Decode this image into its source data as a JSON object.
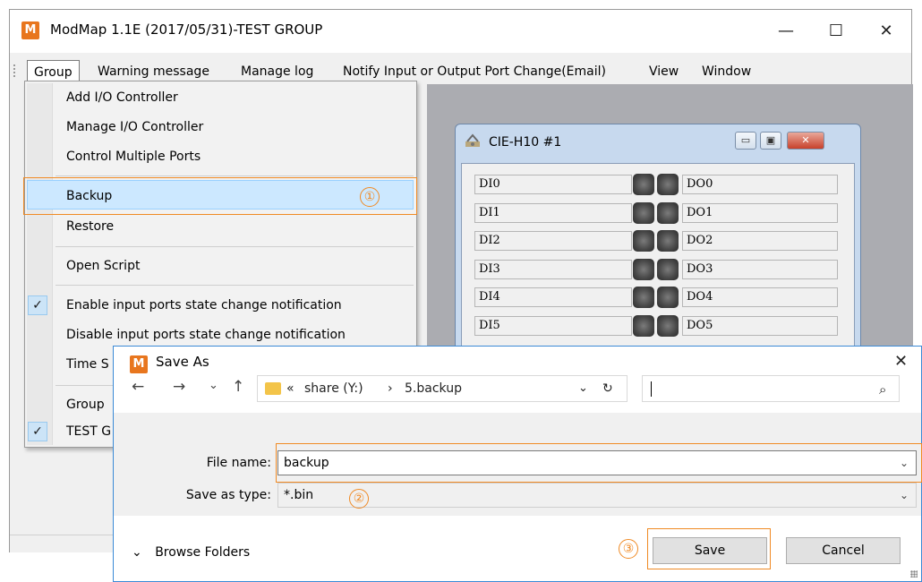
{
  "window": {
    "title": "ModMap 1.1E (2017/05/31)-TEST GROUP",
    "icon_letter": "M",
    "minimize_glyph": "—",
    "maximize_glyph": "☐",
    "close_glyph": "✕"
  },
  "menubar": {
    "items": [
      "Group",
      "Warning message",
      "Manage log",
      "Notify Input or Output Port Change(Email)",
      "View",
      "Window"
    ]
  },
  "group_menu": {
    "items": [
      {
        "label": "Add I/O Controller"
      },
      {
        "label": "Manage I/O Controller"
      },
      {
        "label": "Control Multiple Ports"
      },
      {
        "label": "Backup"
      },
      {
        "label": "Restore"
      },
      {
        "label": "Open Script"
      },
      {
        "label": "Enable input ports state change notification",
        "checked": true
      },
      {
        "label": "Disable input ports state change notification"
      },
      {
        "label": "Time S"
      },
      {
        "label": "Group"
      },
      {
        "label": "TEST G",
        "checked": true
      }
    ],
    "check_glyph": "✓"
  },
  "steps": {
    "one": "①",
    "two": "②",
    "three": "③"
  },
  "device_window": {
    "title": "CIE-H10 #1",
    "min_glyph": "▭",
    "max_glyph": "▣",
    "close_glyph": "✕",
    "inputs": [
      "DI0",
      "DI1",
      "DI2",
      "DI3",
      "DI4",
      "DI5"
    ],
    "outputs": [
      "DO0",
      "DO1",
      "DO2",
      "DO3",
      "DO4",
      "DO5"
    ]
  },
  "save_dialog": {
    "title": "Save As",
    "close_glyph": "✕",
    "nav": {
      "back": "←",
      "forward": "→",
      "dropdown": "⌄",
      "up": "↑",
      "refresh": "↻",
      "address_chevron": "⌄",
      "search_icon": "⌕"
    },
    "address": {
      "prefix": "«",
      "segment1": "share (Y:)",
      "separator": "›",
      "segment2": "5.backup"
    },
    "search_placeholder": "",
    "file_name_label": "File name:",
    "file_name_value": "backup",
    "save_type_label": "Save as type:",
    "save_type_value": "*.bin",
    "combo_chevron": "⌄",
    "browse_label": "Browse Folders",
    "browse_chevron": "⌄",
    "save_button": "Save",
    "cancel_button": "Cancel"
  },
  "colors": {
    "accent_orange": "#f08a24",
    "menu_highlight": "#cce8ff",
    "workarea_gray": "#abacb1",
    "dialog_border": "#3b8ad6"
  }
}
